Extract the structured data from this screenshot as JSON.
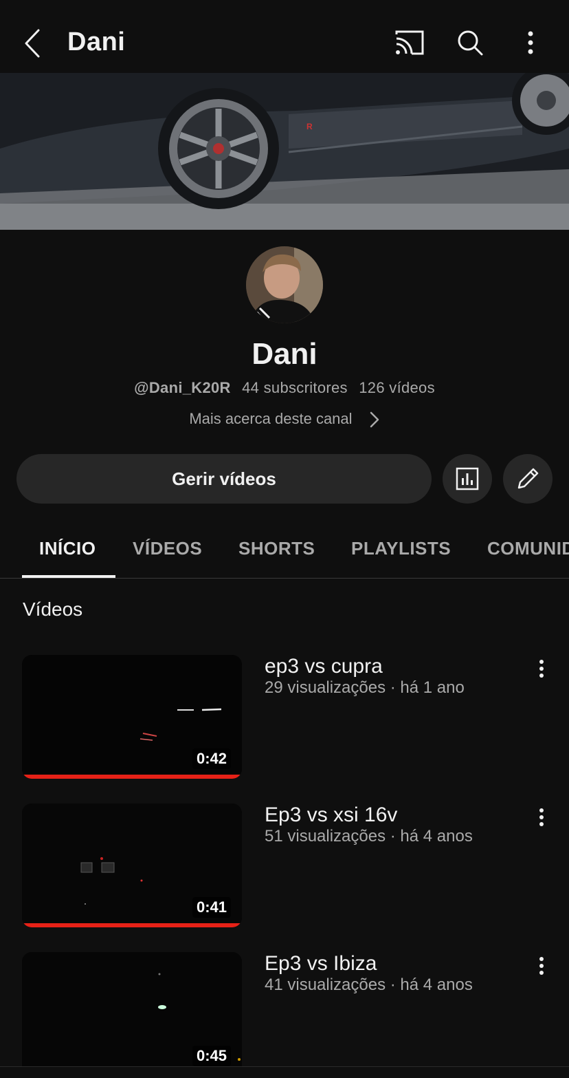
{
  "header": {
    "title": "Dani"
  },
  "channel": {
    "name": "Dani",
    "handle": "@Dani_K20R",
    "subscribers": "44 subscritores",
    "videos_count": "126 vídeos",
    "about": "Mais acerca deste canal"
  },
  "actions": {
    "manage_label": "Gerir vídeos"
  },
  "tabs": [
    {
      "label": "INÍCIO",
      "active": true
    },
    {
      "label": "VÍDEOS",
      "active": false
    },
    {
      "label": "SHORTS",
      "active": false
    },
    {
      "label": "PLAYLISTS",
      "active": false
    },
    {
      "label": "COMUNIDADE",
      "active": false
    }
  ],
  "section": {
    "title": "Vídeos"
  },
  "videos": [
    {
      "title": "ep3 vs cupra",
      "meta": "29 visualizações · há 1 ano",
      "duration": "0:42",
      "watched_fraction": 1.0
    },
    {
      "title": "Ep3 vs xsi 16v",
      "meta": "51 visualizações · há 4 anos",
      "duration": "0:41",
      "watched_fraction": 1.0
    },
    {
      "title": "Ep3 vs Ibiza",
      "meta": "41 visualizações · há 4 anos",
      "duration": "0:45",
      "watched_fraction": 0.0
    }
  ],
  "colors": {
    "background": "#0f0f0f",
    "surface": "#272727",
    "progress": "#e62117",
    "secondary_text": "#aaaaaa"
  },
  "icons": [
    "back-icon",
    "cast-icon",
    "search-icon",
    "more-vert-icon",
    "analytics-icon",
    "edit-pencil-icon",
    "chevron-right-icon"
  ]
}
